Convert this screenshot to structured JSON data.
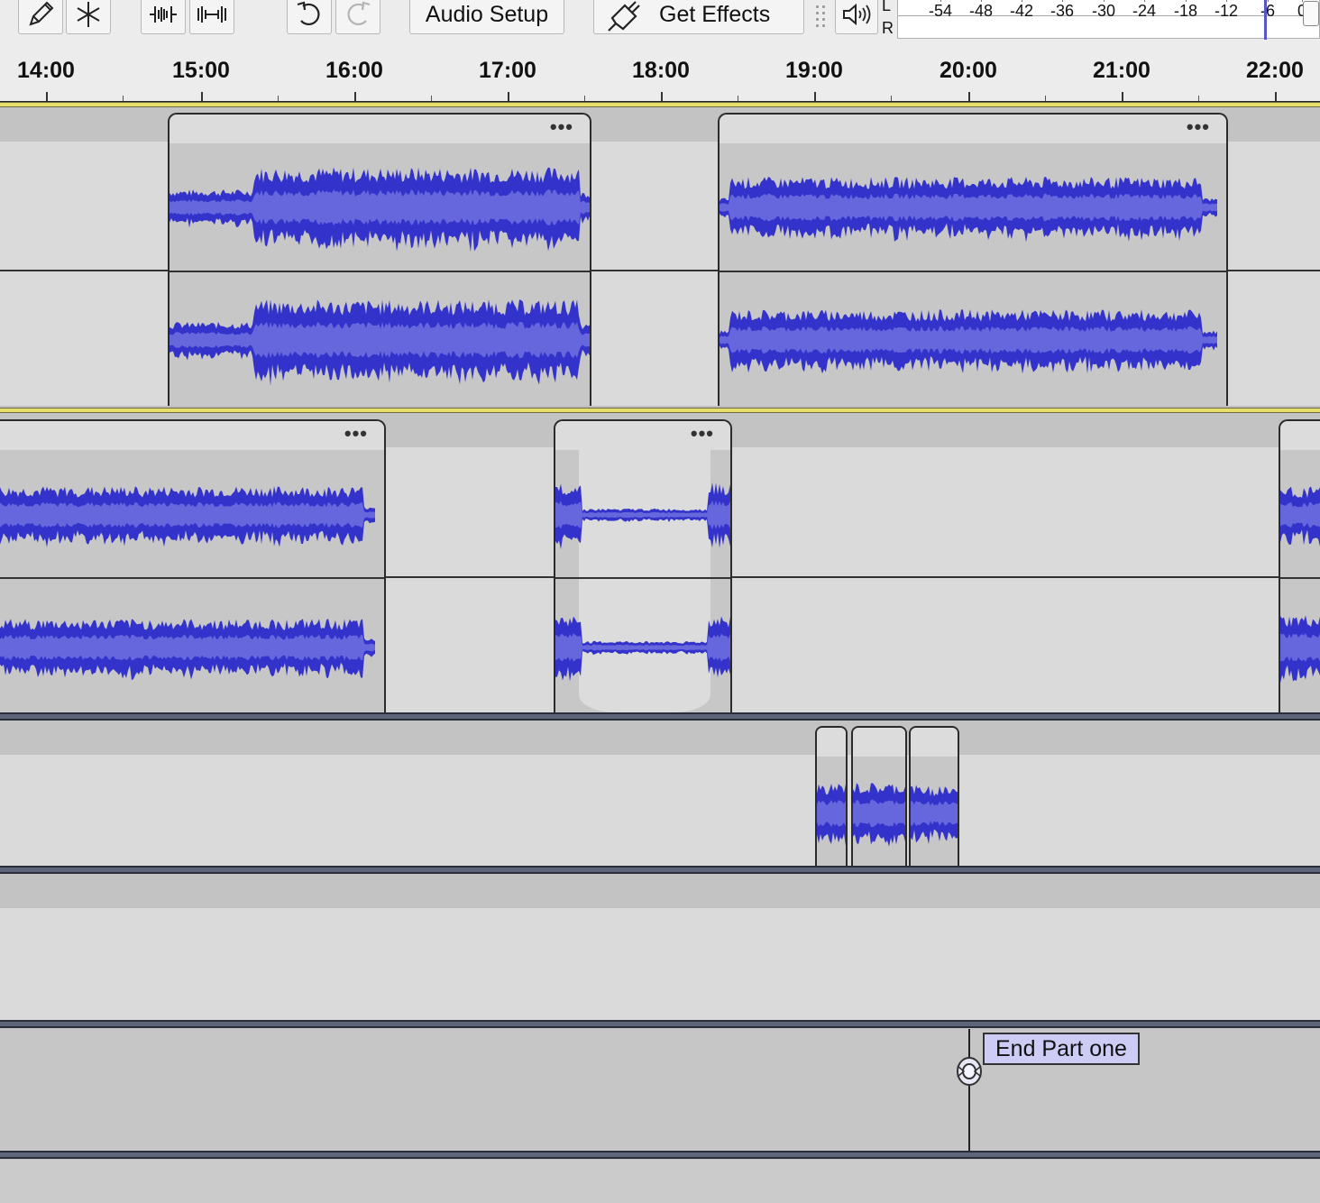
{
  "toolbar": {
    "tools": [
      {
        "name": "draw-tool",
        "icon": "pencil-icon"
      },
      {
        "name": "multi-tool",
        "icon": "asterisk-icon"
      },
      {
        "name": "trim-outside-tool",
        "icon": "trim-audio-icon"
      },
      {
        "name": "silence-tool",
        "icon": "silence-audio-icon"
      },
      {
        "name": "undo",
        "icon": "undo-icon"
      },
      {
        "name": "redo",
        "icon": "redo-icon",
        "disabled": true
      }
    ],
    "audio_setup_label": "Audio Setup",
    "get_effects_label": "Get Effects",
    "get_effects_icon": "plug-icon",
    "speaker_icon": "speaker-icon"
  },
  "meter": {
    "channel_left": "L",
    "channel_right": "R",
    "ticks": [
      "-54",
      "-48",
      "-42",
      "-36",
      "-30",
      "-24",
      "-18",
      "-12",
      "-6",
      "0"
    ],
    "level_marker_db": -6
  },
  "ruler": {
    "labels": [
      "14:00",
      "15:00",
      "16:00",
      "17:00",
      "18:00",
      "19:00",
      "20:00",
      "21:00",
      "22:00"
    ]
  },
  "tracks": {
    "clip_menu_glyph": "•••"
  },
  "label_track": {
    "label_text": "End Part one"
  },
  "colors": {
    "waveform": "#3333cc",
    "waveform_rms": "#6666dd",
    "label_fill": "#ccccf4",
    "track_separator": "#5e6479",
    "selected_track_edge": "#e8de6a"
  }
}
